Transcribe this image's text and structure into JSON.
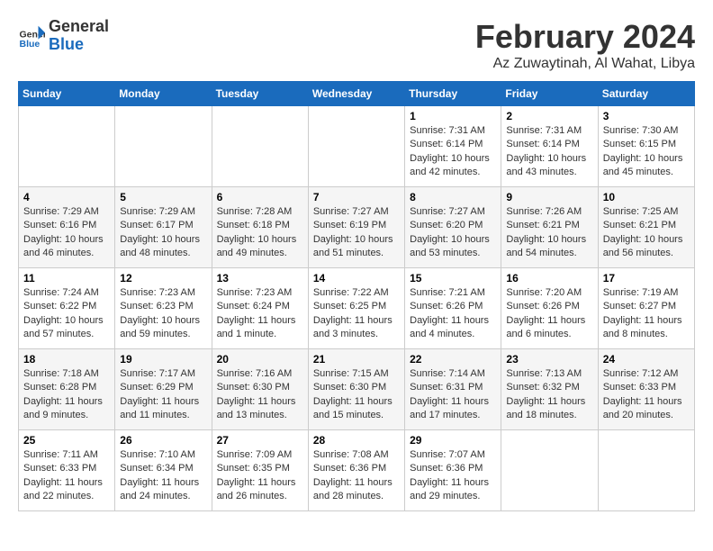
{
  "logo": {
    "line1": "General",
    "line2": "Blue"
  },
  "title": "February 2024",
  "subtitle": "Az Zuwaytinah, Al Wahat, Libya",
  "days_of_week": [
    "Sunday",
    "Monday",
    "Tuesday",
    "Wednesday",
    "Thursday",
    "Friday",
    "Saturday"
  ],
  "weeks": [
    [
      {
        "day": "",
        "content": ""
      },
      {
        "day": "",
        "content": ""
      },
      {
        "day": "",
        "content": ""
      },
      {
        "day": "",
        "content": ""
      },
      {
        "day": "1",
        "content": "Sunrise: 7:31 AM\nSunset: 6:14 PM\nDaylight: 10 hours and 42 minutes."
      },
      {
        "day": "2",
        "content": "Sunrise: 7:31 AM\nSunset: 6:14 PM\nDaylight: 10 hours and 43 minutes."
      },
      {
        "day": "3",
        "content": "Sunrise: 7:30 AM\nSunset: 6:15 PM\nDaylight: 10 hours and 45 minutes."
      }
    ],
    [
      {
        "day": "4",
        "content": "Sunrise: 7:29 AM\nSunset: 6:16 PM\nDaylight: 10 hours and 46 minutes."
      },
      {
        "day": "5",
        "content": "Sunrise: 7:29 AM\nSunset: 6:17 PM\nDaylight: 10 hours and 48 minutes."
      },
      {
        "day": "6",
        "content": "Sunrise: 7:28 AM\nSunset: 6:18 PM\nDaylight: 10 hours and 49 minutes."
      },
      {
        "day": "7",
        "content": "Sunrise: 7:27 AM\nSunset: 6:19 PM\nDaylight: 10 hours and 51 minutes."
      },
      {
        "day": "8",
        "content": "Sunrise: 7:27 AM\nSunset: 6:20 PM\nDaylight: 10 hours and 53 minutes."
      },
      {
        "day": "9",
        "content": "Sunrise: 7:26 AM\nSunset: 6:21 PM\nDaylight: 10 hours and 54 minutes."
      },
      {
        "day": "10",
        "content": "Sunrise: 7:25 AM\nSunset: 6:21 PM\nDaylight: 10 hours and 56 minutes."
      }
    ],
    [
      {
        "day": "11",
        "content": "Sunrise: 7:24 AM\nSunset: 6:22 PM\nDaylight: 10 hours and 57 minutes."
      },
      {
        "day": "12",
        "content": "Sunrise: 7:23 AM\nSunset: 6:23 PM\nDaylight: 10 hours and 59 minutes."
      },
      {
        "day": "13",
        "content": "Sunrise: 7:23 AM\nSunset: 6:24 PM\nDaylight: 11 hours and 1 minute."
      },
      {
        "day": "14",
        "content": "Sunrise: 7:22 AM\nSunset: 6:25 PM\nDaylight: 11 hours and 3 minutes."
      },
      {
        "day": "15",
        "content": "Sunrise: 7:21 AM\nSunset: 6:26 PM\nDaylight: 11 hours and 4 minutes."
      },
      {
        "day": "16",
        "content": "Sunrise: 7:20 AM\nSunset: 6:26 PM\nDaylight: 11 hours and 6 minutes."
      },
      {
        "day": "17",
        "content": "Sunrise: 7:19 AM\nSunset: 6:27 PM\nDaylight: 11 hours and 8 minutes."
      }
    ],
    [
      {
        "day": "18",
        "content": "Sunrise: 7:18 AM\nSunset: 6:28 PM\nDaylight: 11 hours and 9 minutes."
      },
      {
        "day": "19",
        "content": "Sunrise: 7:17 AM\nSunset: 6:29 PM\nDaylight: 11 hours and 11 minutes."
      },
      {
        "day": "20",
        "content": "Sunrise: 7:16 AM\nSunset: 6:30 PM\nDaylight: 11 hours and 13 minutes."
      },
      {
        "day": "21",
        "content": "Sunrise: 7:15 AM\nSunset: 6:30 PM\nDaylight: 11 hours and 15 minutes."
      },
      {
        "day": "22",
        "content": "Sunrise: 7:14 AM\nSunset: 6:31 PM\nDaylight: 11 hours and 17 minutes."
      },
      {
        "day": "23",
        "content": "Sunrise: 7:13 AM\nSunset: 6:32 PM\nDaylight: 11 hours and 18 minutes."
      },
      {
        "day": "24",
        "content": "Sunrise: 7:12 AM\nSunset: 6:33 PM\nDaylight: 11 hours and 20 minutes."
      }
    ],
    [
      {
        "day": "25",
        "content": "Sunrise: 7:11 AM\nSunset: 6:33 PM\nDaylight: 11 hours and 22 minutes."
      },
      {
        "day": "26",
        "content": "Sunrise: 7:10 AM\nSunset: 6:34 PM\nDaylight: 11 hours and 24 minutes."
      },
      {
        "day": "27",
        "content": "Sunrise: 7:09 AM\nSunset: 6:35 PM\nDaylight: 11 hours and 26 minutes."
      },
      {
        "day": "28",
        "content": "Sunrise: 7:08 AM\nSunset: 6:36 PM\nDaylight: 11 hours and 28 minutes."
      },
      {
        "day": "29",
        "content": "Sunrise: 7:07 AM\nSunset: 6:36 PM\nDaylight: 11 hours and 29 minutes."
      },
      {
        "day": "",
        "content": ""
      },
      {
        "day": "",
        "content": ""
      }
    ]
  ]
}
